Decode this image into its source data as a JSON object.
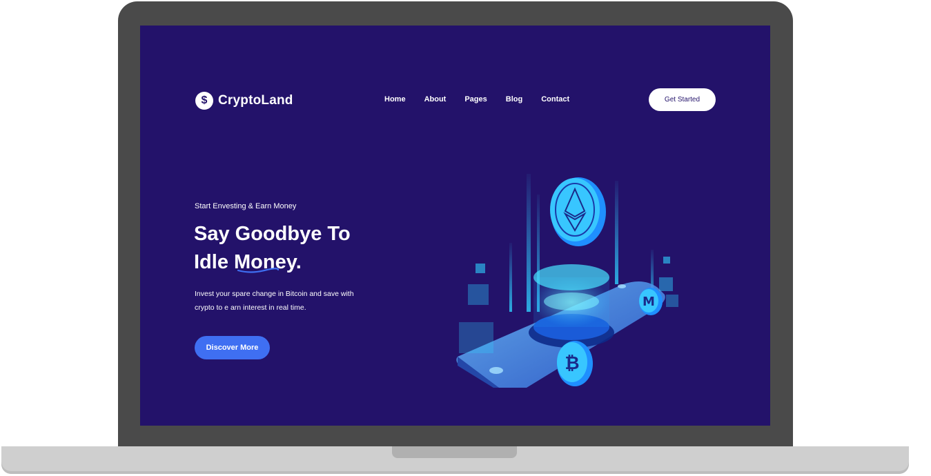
{
  "brand": {
    "name": "CryptoLand",
    "icon": "dollar-coin-icon"
  },
  "nav": {
    "items": [
      {
        "label": "Home"
      },
      {
        "label": "About"
      },
      {
        "label": "Pages"
      },
      {
        "label": "Blog"
      },
      {
        "label": "Contact"
      }
    ],
    "cta_label": "Get Started"
  },
  "hero": {
    "kicker": "Start Envesting & Earn Money",
    "headline_line1": "Say Goodbye To",
    "headline_line2": "Idle Money.",
    "description": "Invest your spare change in Bitcoin and save with crypto to e arn interest in real time.",
    "button_label": "Discover More"
  },
  "illustration": {
    "icons": [
      "ethereum-coin-icon",
      "bitcoin-coin-icon",
      "monero-coin-icon"
    ]
  },
  "colors": {
    "background": "#23126a",
    "accent_button": "#3f6ff2",
    "laptop_frame": "#4a4a4a",
    "laptop_base": "#cfcfcf",
    "illustration_cyan": "#2fd0ff"
  }
}
